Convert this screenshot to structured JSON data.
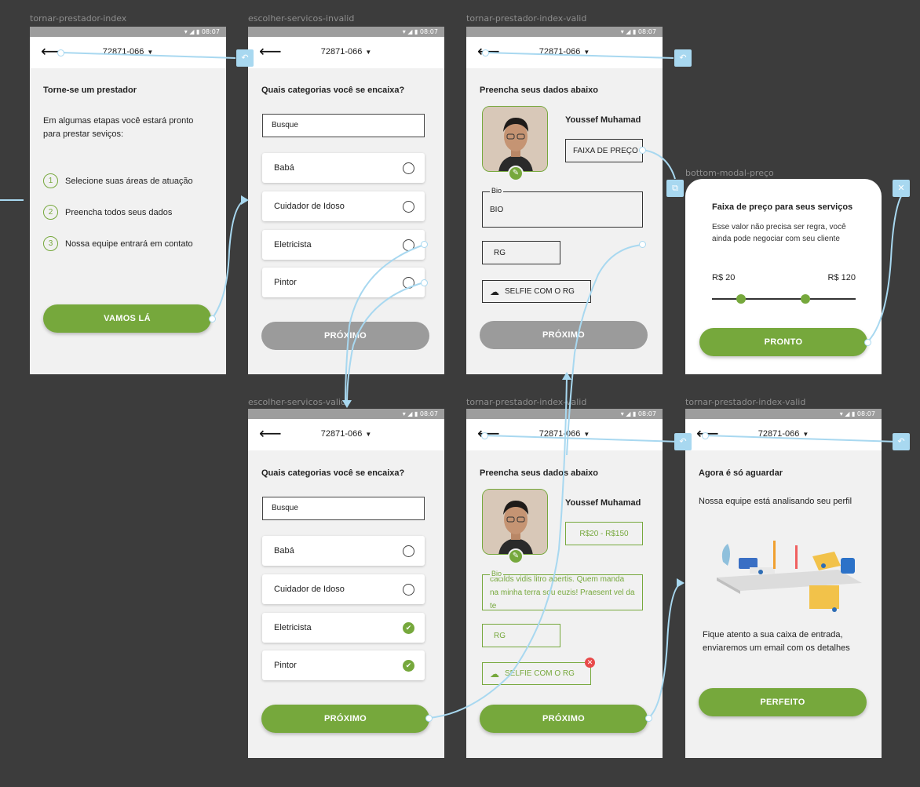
{
  "frames": {
    "f1": "tornar-prestador-index",
    "f2": "escolher-servicos-invalid",
    "f3": "tornar-prestador-index-valid",
    "f4": "bottom-modal-preço",
    "f5": "escolher-servicos-valid",
    "f6": "tornar-prestador-index-valid",
    "f7": "tornar-prestador-index-valid"
  },
  "status": {
    "time": "▾ ◢ ▮ 08:07"
  },
  "appbar": {
    "back_icon": "arrow-left-icon",
    "cep": "72871-066"
  },
  "intro": {
    "title": "Torne-se um prestador",
    "text": "Em algumas etapas você estará pronto para prestar seviços:",
    "steps": [
      {
        "n": "1",
        "label": "Selecione suas áreas de atuação"
      },
      {
        "n": "2",
        "label": "Preencha todos seus dados"
      },
      {
        "n": "3",
        "label": "Nossa equipe entrará em contato"
      }
    ],
    "button": "VAMOS LÁ"
  },
  "services": {
    "title": "Quais categorias você se encaixa?",
    "search_placeholder": "Busque",
    "items": [
      "Babá",
      "Cuidador de Idoso",
      "Eletricista",
      "Pintor"
    ],
    "button": "PRÓXIMO",
    "selected_in_valid": [
      "Eletricista",
      "Pintor"
    ]
  },
  "profile": {
    "title": "Preencha seus dados abaixo",
    "name": "Youssef Muhamad",
    "price_placeholder": "FAIXA DE PREÇO",
    "price_value": "R$20 - R$150",
    "bio_label": "Bio",
    "bio_placeholder": "BIO",
    "bio_value": "cacilds vidis litro abertis. Quem manda na minha terra sou euzis! Praesent vel da te",
    "rg": "RG",
    "selfie": "SELFIE COM O RG",
    "button": "PRÓXIMO"
  },
  "price_modal": {
    "title": "Faixa de preço para seus serviços",
    "text": "Esse valor não precisa ser regra, você ainda pode negociar com seu cliente",
    "min": "R$ 20",
    "max": "R$ 120",
    "min_fraction": 0.2,
    "max_fraction": 0.65,
    "button": "PRONTO"
  },
  "waiting": {
    "title": "Agora é só aguardar",
    "text": "Nossa equipe está analisando seu perfil",
    "text2": "Fique atento a sua caixa de entrada, enviaremos um email com os detalhes",
    "button": "PERFEITO"
  },
  "colors": {
    "accent": "#76a83c",
    "link": "#a8d8f0",
    "disabled": "#9b9b9b",
    "error": "#e84a4a"
  }
}
